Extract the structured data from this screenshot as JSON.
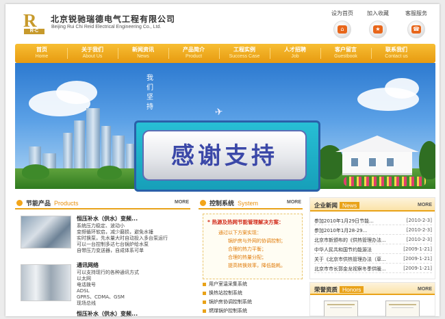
{
  "header": {
    "company_cn": "北京锐驰瑞德电气工程有限公司",
    "company_en": "Beijing Rui Chi Reid Electrical Engineering Co., Ltd.",
    "logo_letters": "R",
    "logo_sub": "R·C",
    "quick_links": [
      {
        "label": "设为首页",
        "icon": "home-icon"
      },
      {
        "label": "加入收藏",
        "icon": "favorite-icon"
      },
      {
        "label": "客服服务",
        "icon": "service-icon"
      }
    ]
  },
  "nav": [
    {
      "cn": "首页",
      "en": "Home"
    },
    {
      "cn": "关于我们",
      "en": "About Us"
    },
    {
      "cn": "新闻资讯",
      "en": "News"
    },
    {
      "cn": "产品简介",
      "en": "Product"
    },
    {
      "cn": "工程实例",
      "en": "Success Case"
    },
    {
      "cn": "人才招聘",
      "en": "Job"
    },
    {
      "cn": "客户留言",
      "en": "Guestbook"
    },
    {
      "cn": "联系我们",
      "en": "Contact us"
    }
  ],
  "banner": {
    "vertical_text": "我们坚持"
  },
  "overlay": {
    "text": "感谢支持"
  },
  "products": {
    "title": "节能产品",
    "title_en": "Products",
    "more": "MORE",
    "items": [
      {
        "title": "恒压补水（供水）变频...",
        "lines": [
          "系统压力稳定、波动小",
          "变频循环软启，减少磨损，避免水锤",
          "实时换泵，先水量大时自动投入多台泵运行",
          "可以一台控制多达七台锅炉给水泵",
          "自带压力变送器，自成体系可单"
        ]
      },
      {
        "title": "通讯网络",
        "lines": [
          "可以支持现行的各种通讯方式",
          "以太网",
          "电话拨号",
          "ADSL",
          "GPRS、CDMA、GSM",
          "现场总线"
        ]
      }
    ],
    "partial_title": "恒压补水（供水）变频..."
  },
  "control": {
    "title": "控制系统",
    "title_en": "System",
    "more": "MORE",
    "box_title": "* 热源及热网节能管理解决方案：",
    "box_lines": [
      "通过以下方案实现：",
      "锅炉房与外网的协调控制；",
      "合理的热力平衡；",
      "合理的热量分配；",
      "提高转换效率，降低能耗。"
    ],
    "systems": [
      "用户室温采集系统",
      "换热站控制系统",
      "锅炉房协调控制系统",
      "燃煤锅炉控制系统"
    ]
  },
  "news": {
    "title": "企业新闻",
    "title_en": "News",
    "more": "MORE",
    "items": [
      {
        "title": "参加2010年1月29日节能...",
        "date": "[2010-2-3]"
      },
      {
        "title": "参加2010年1月28-29...",
        "date": "[2010-2-3]"
      },
      {
        "title": "北京市新颁布的《供热管理办法...",
        "date": "[2010-2-3]"
      },
      {
        "title": "中华人民共和国节约能源法",
        "date": "[2009-1-21]"
      },
      {
        "title": "关于《北京市供热管理办法（草...",
        "date": "[2009-1-21]"
      },
      {
        "title": "北京市市长郭金龙视察冬季供暖...",
        "date": "[2009-1-21]"
      }
    ]
  },
  "honors": {
    "title": "荣誉资质",
    "title_en": "Honors",
    "more": "MORE"
  },
  "colors": {
    "accent": "#e9a218",
    "nav_top": "#f7be33",
    "nav_bottom": "#e79a10",
    "overlay_text": "#3b48a8",
    "overlay_frame": "#1fb0c8"
  }
}
